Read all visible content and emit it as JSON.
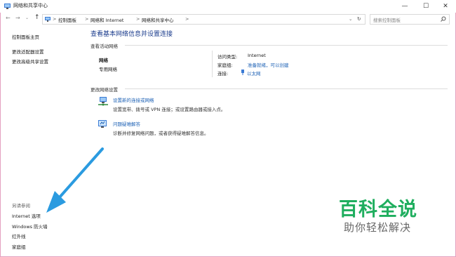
{
  "window": {
    "title": "网络和共享中心",
    "minimize": "—",
    "maximize": "☐",
    "close": "✕"
  },
  "address": {
    "crumbs": [
      "控制面板",
      "网络和 Internet",
      "网络和共享中心"
    ],
    "separator": ">",
    "search_placeholder": "搜索控制面板"
  },
  "sidebar": {
    "home": "控制面板主页",
    "items": [
      "更改适配器设置",
      "更改高级共享设置"
    ],
    "see_also_title": "另请参阅",
    "see_also": [
      "Internet 选项",
      "Windows 防火墙",
      "红外线",
      "家庭组"
    ]
  },
  "main": {
    "heading": "查看基本网络信息并设置连接",
    "active_title": "查看活动网络",
    "network_name": "网络",
    "network_type": "专用网络",
    "access_label": "访问类型:",
    "access_value": "Internet",
    "homegroup_label": "家庭组:",
    "homegroup_value": "准备就绪，可以创建",
    "connection_label": "连接:",
    "connection_value": "以太网",
    "change_title": "更改网络设置",
    "task1_link": "设置新的连接或网络",
    "task1_desc": "设置宽带、拨号或 VPN 连接；或设置路由器或接入点。",
    "task2_link": "问题疑难解答",
    "task2_desc": "诊断并修复网络问题，或者获得疑难解答信息。"
  },
  "watermark": {
    "big": "百科全说",
    "small": "助你轻松解决"
  },
  "colors": {
    "link": "#1a5fb4",
    "arrow": "#2b9be0",
    "watermark_green": "#1fae5e"
  }
}
